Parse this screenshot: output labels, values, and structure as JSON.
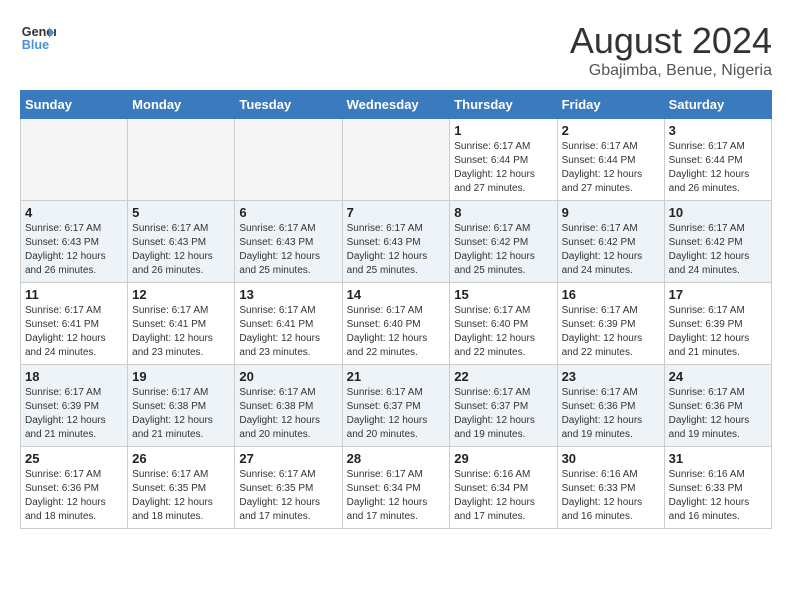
{
  "header": {
    "logo_line1": "General",
    "logo_line2": "Blue",
    "month_title": "August 2024",
    "location": "Gbajimba, Benue, Nigeria"
  },
  "weekdays": [
    "Sunday",
    "Monday",
    "Tuesday",
    "Wednesday",
    "Thursday",
    "Friday",
    "Saturday"
  ],
  "weeks": [
    [
      {
        "day": "",
        "info": ""
      },
      {
        "day": "",
        "info": ""
      },
      {
        "day": "",
        "info": ""
      },
      {
        "day": "",
        "info": ""
      },
      {
        "day": "1",
        "info": "Sunrise: 6:17 AM\nSunset: 6:44 PM\nDaylight: 12 hours\nand 27 minutes."
      },
      {
        "day": "2",
        "info": "Sunrise: 6:17 AM\nSunset: 6:44 PM\nDaylight: 12 hours\nand 27 minutes."
      },
      {
        "day": "3",
        "info": "Sunrise: 6:17 AM\nSunset: 6:44 PM\nDaylight: 12 hours\nand 26 minutes."
      }
    ],
    [
      {
        "day": "4",
        "info": "Sunrise: 6:17 AM\nSunset: 6:43 PM\nDaylight: 12 hours\nand 26 minutes."
      },
      {
        "day": "5",
        "info": "Sunrise: 6:17 AM\nSunset: 6:43 PM\nDaylight: 12 hours\nand 26 minutes."
      },
      {
        "day": "6",
        "info": "Sunrise: 6:17 AM\nSunset: 6:43 PM\nDaylight: 12 hours\nand 25 minutes."
      },
      {
        "day": "7",
        "info": "Sunrise: 6:17 AM\nSunset: 6:43 PM\nDaylight: 12 hours\nand 25 minutes."
      },
      {
        "day": "8",
        "info": "Sunrise: 6:17 AM\nSunset: 6:42 PM\nDaylight: 12 hours\nand 25 minutes."
      },
      {
        "day": "9",
        "info": "Sunrise: 6:17 AM\nSunset: 6:42 PM\nDaylight: 12 hours\nand 24 minutes."
      },
      {
        "day": "10",
        "info": "Sunrise: 6:17 AM\nSunset: 6:42 PM\nDaylight: 12 hours\nand 24 minutes."
      }
    ],
    [
      {
        "day": "11",
        "info": "Sunrise: 6:17 AM\nSunset: 6:41 PM\nDaylight: 12 hours\nand 24 minutes."
      },
      {
        "day": "12",
        "info": "Sunrise: 6:17 AM\nSunset: 6:41 PM\nDaylight: 12 hours\nand 23 minutes."
      },
      {
        "day": "13",
        "info": "Sunrise: 6:17 AM\nSunset: 6:41 PM\nDaylight: 12 hours\nand 23 minutes."
      },
      {
        "day": "14",
        "info": "Sunrise: 6:17 AM\nSunset: 6:40 PM\nDaylight: 12 hours\nand 22 minutes."
      },
      {
        "day": "15",
        "info": "Sunrise: 6:17 AM\nSunset: 6:40 PM\nDaylight: 12 hours\nand 22 minutes."
      },
      {
        "day": "16",
        "info": "Sunrise: 6:17 AM\nSunset: 6:39 PM\nDaylight: 12 hours\nand 22 minutes."
      },
      {
        "day": "17",
        "info": "Sunrise: 6:17 AM\nSunset: 6:39 PM\nDaylight: 12 hours\nand 21 minutes."
      }
    ],
    [
      {
        "day": "18",
        "info": "Sunrise: 6:17 AM\nSunset: 6:39 PM\nDaylight: 12 hours\nand 21 minutes."
      },
      {
        "day": "19",
        "info": "Sunrise: 6:17 AM\nSunset: 6:38 PM\nDaylight: 12 hours\nand 21 minutes."
      },
      {
        "day": "20",
        "info": "Sunrise: 6:17 AM\nSunset: 6:38 PM\nDaylight: 12 hours\nand 20 minutes."
      },
      {
        "day": "21",
        "info": "Sunrise: 6:17 AM\nSunset: 6:37 PM\nDaylight: 12 hours\nand 20 minutes."
      },
      {
        "day": "22",
        "info": "Sunrise: 6:17 AM\nSunset: 6:37 PM\nDaylight: 12 hours\nand 19 minutes."
      },
      {
        "day": "23",
        "info": "Sunrise: 6:17 AM\nSunset: 6:36 PM\nDaylight: 12 hours\nand 19 minutes."
      },
      {
        "day": "24",
        "info": "Sunrise: 6:17 AM\nSunset: 6:36 PM\nDaylight: 12 hours\nand 19 minutes."
      }
    ],
    [
      {
        "day": "25",
        "info": "Sunrise: 6:17 AM\nSunset: 6:36 PM\nDaylight: 12 hours\nand 18 minutes."
      },
      {
        "day": "26",
        "info": "Sunrise: 6:17 AM\nSunset: 6:35 PM\nDaylight: 12 hours\nand 18 minutes."
      },
      {
        "day": "27",
        "info": "Sunrise: 6:17 AM\nSunset: 6:35 PM\nDaylight: 12 hours\nand 17 minutes."
      },
      {
        "day": "28",
        "info": "Sunrise: 6:17 AM\nSunset: 6:34 PM\nDaylight: 12 hours\nand 17 minutes."
      },
      {
        "day": "29",
        "info": "Sunrise: 6:16 AM\nSunset: 6:34 PM\nDaylight: 12 hours\nand 17 minutes."
      },
      {
        "day": "30",
        "info": "Sunrise: 6:16 AM\nSunset: 6:33 PM\nDaylight: 12 hours\nand 16 minutes."
      },
      {
        "day": "31",
        "info": "Sunrise: 6:16 AM\nSunset: 6:33 PM\nDaylight: 12 hours\nand 16 minutes."
      }
    ]
  ]
}
